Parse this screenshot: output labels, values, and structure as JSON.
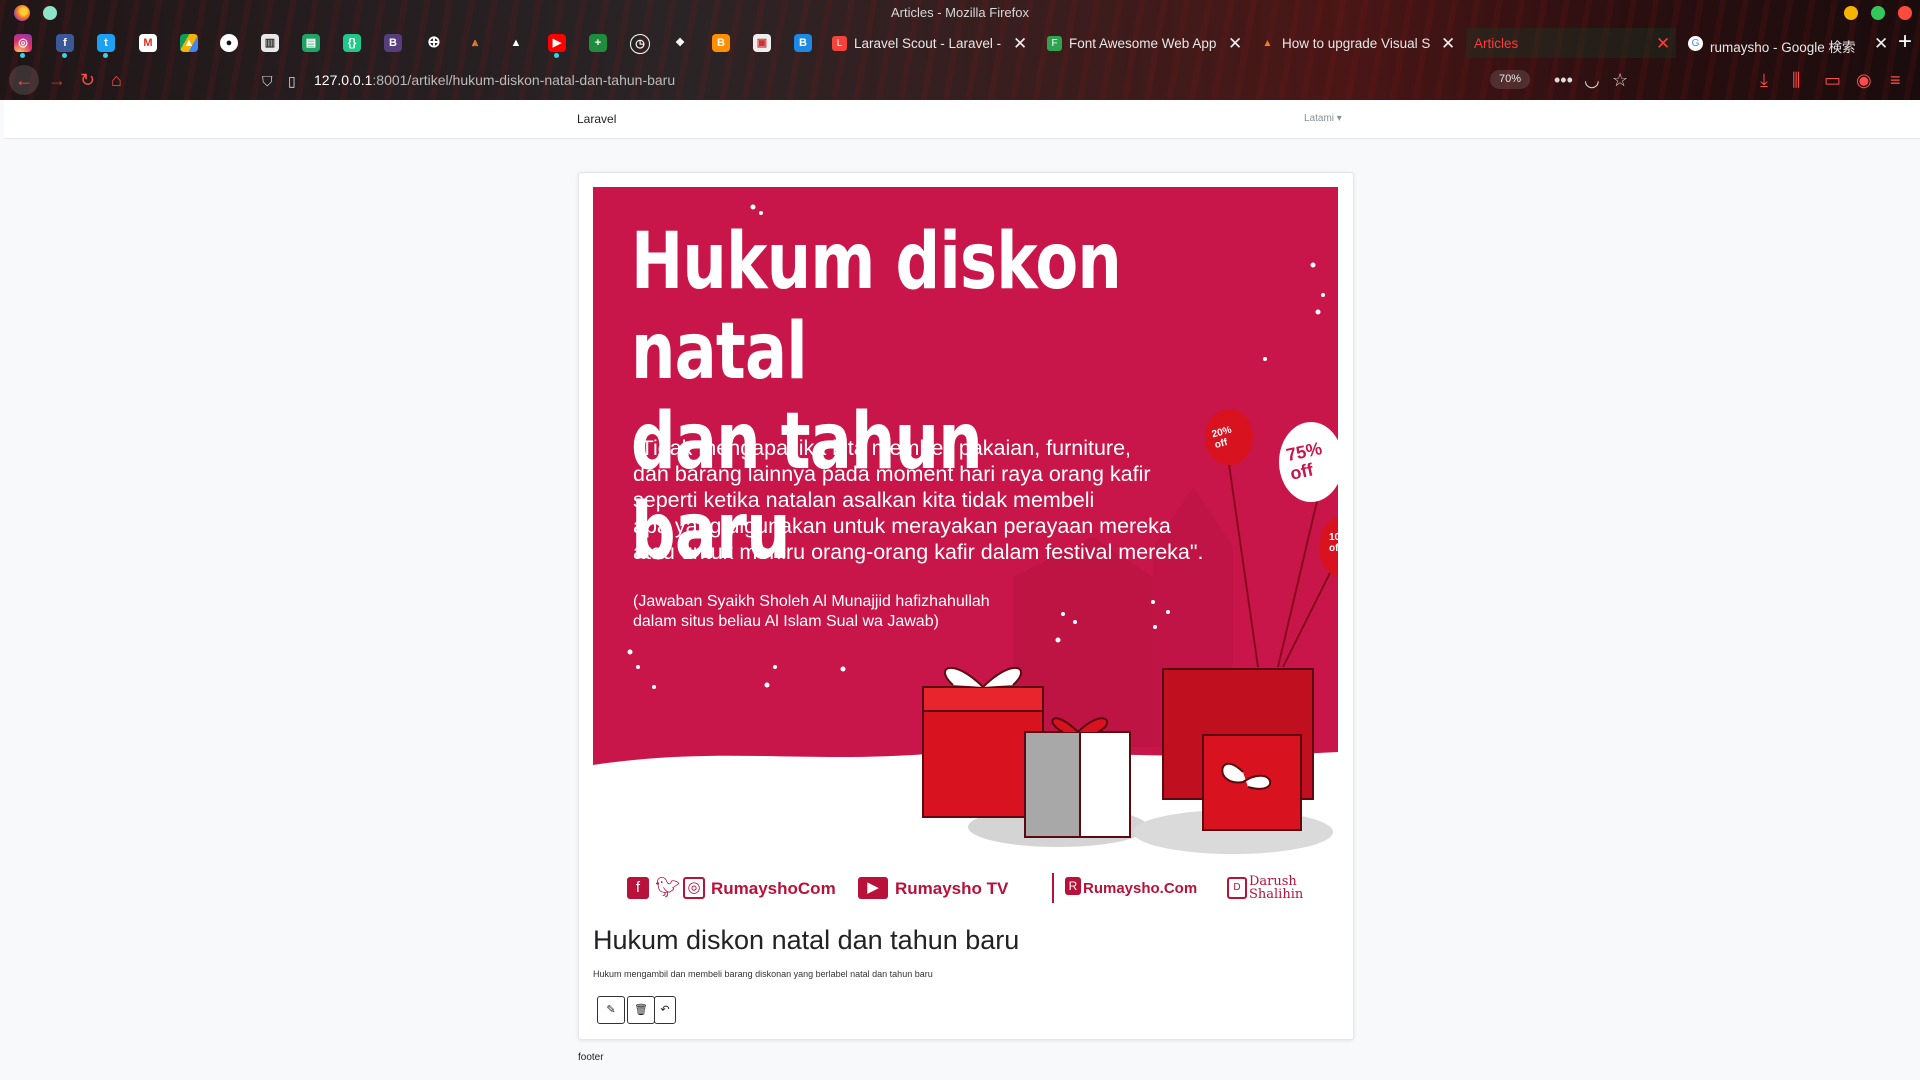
{
  "window": {
    "title": "Articles - Mozilla Firefox"
  },
  "tabs": [
    {
      "label": "Laravel Scout - Laravel -",
      "favicon": "laravel-icon",
      "active": false
    },
    {
      "label": "Font Awesome Web App",
      "favicon": "font-awesome-icon",
      "active": false
    },
    {
      "label": "How to upgrade Visual S",
      "favicon": "stackoverflow-icon",
      "active": false
    },
    {
      "label": "Articles",
      "favicon": "none",
      "active": true
    },
    {
      "label": "rumaysho - Google 検索",
      "favicon": "google-icon",
      "active": false
    }
  ],
  "pinned_tabs": [
    "instagram-icon",
    "facebook-icon",
    "twitter-icon",
    "gmail-icon",
    "google-drive-icon",
    "github-icon",
    "trello-icon",
    "sheets-icon",
    "json-icon",
    "bootstrap-icon",
    "globe-icon",
    "cone-icon",
    "alert-icon",
    "youtube-icon",
    "sheets-plus-icon",
    "timer-icon",
    "mindmap-icon",
    "blogger-icon",
    "app-icon",
    "b-icon"
  ],
  "toolbar": {
    "url_host": "127.0.0.1",
    "url_rest": ":8001/artikel/hukum-diskon-natal-dan-tahun-baru",
    "zoom": "70%"
  },
  "site": {
    "brand": "Laravel",
    "user_menu": "Latami"
  },
  "article": {
    "image": {
      "title_line1": "Hukum diskon natal",
      "title_line2": "dan tahun baru",
      "quote_line1": "\"Tidak mengapa jika kita membeli pakaian, furniture,",
      "quote_line2": "dan barang lainnya pada moment hari raya orang kafir",
      "quote_line3": "seperti ketika natalan asalkan kita tidak membeli",
      "quote_line4": "apa yang digunakan untuk merayakan perayaan mereka",
      "quote_line5": "atau untuk meniru orang-orang kafir dalam festival mereka\".",
      "source_line1": "(Jawaban Syaikh Sholeh Al Munajjid hafizhahullah",
      "source_line2": "dalam situs beliau Al Islam Sual wa Jawab)",
      "balloon1": "20% off",
      "balloon2": "75% off",
      "balloon3": "10 off",
      "social_handle": "RumayshoCom",
      "youtube_channel": "Rumaysho TV",
      "site_logo": "Rumaysho.Com",
      "partner_logo_line1": "Darush",
      "partner_logo_line2": "Shalihin"
    },
    "title": "Hukum diskon natal dan tahun baru",
    "description": "Hukum mengambil dan membeli barang diskonan yang berlabel natal dan tahun baru"
  },
  "footer": "footer",
  "colors": {
    "accent": "#c8164a",
    "gift_red": "#d8121f",
    "tab_active_text": "#ff3b3b"
  }
}
